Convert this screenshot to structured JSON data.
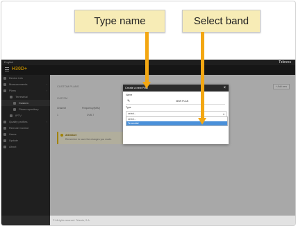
{
  "topbar": {
    "language": "English",
    "brand": "Televes"
  },
  "appbar": {
    "logo": "H30D+"
  },
  "sidebar": {
    "items": [
      {
        "label": "Device info",
        "level": 0,
        "chevron": ""
      },
      {
        "label": "Measurements",
        "level": 0,
        "chevron": "›"
      },
      {
        "label": "Plans",
        "level": 0,
        "chevron": "›"
      },
      {
        "label": "Terrestrial",
        "level": 1,
        "chevron": ""
      },
      {
        "label": "Custom",
        "level": 2,
        "chevron": ""
      },
      {
        "label": "Plans repository",
        "level": 2,
        "chevron": ""
      },
      {
        "label": "IPTV",
        "level": 1,
        "chevron": ""
      },
      {
        "label": "Quality profiles",
        "level": 0,
        "chevron": "›"
      },
      {
        "label": "Remote Control",
        "level": 0,
        "chevron": ""
      },
      {
        "label": "Users",
        "level": 0,
        "chevron": ""
      },
      {
        "label": "Update",
        "level": 0,
        "chevron": ""
      },
      {
        "label": "About",
        "level": 0,
        "chevron": ""
      }
    ]
  },
  "main": {
    "heading": "CUSTOM PLANS",
    "add_button": "+ Add new",
    "plan_row": "CUSTOM",
    "columns": [
      "Channel",
      "Frequency(MHz)"
    ],
    "row_values": [
      "1",
      "DVB-T"
    ],
    "notice_title": "Attention!",
    "notice_text": "Remember to save the changes you made."
  },
  "footer": {
    "text": "© All rights reserved. Televés, S.A."
  },
  "modal": {
    "title": "Create a new Plan",
    "name_label": "Name",
    "name_value": "NEW PLAN",
    "type_label": "Type",
    "select_value": "select...",
    "options": [
      "select...",
      "Terrestrial"
    ],
    "selected_option": "Terrestrial"
  },
  "callouts": {
    "type_name": "Type name",
    "select_band": "Select band"
  },
  "colors": {
    "accent": "#f3a712",
    "callout_bg": "#f7ecb6",
    "selection": "#4a90d9"
  }
}
